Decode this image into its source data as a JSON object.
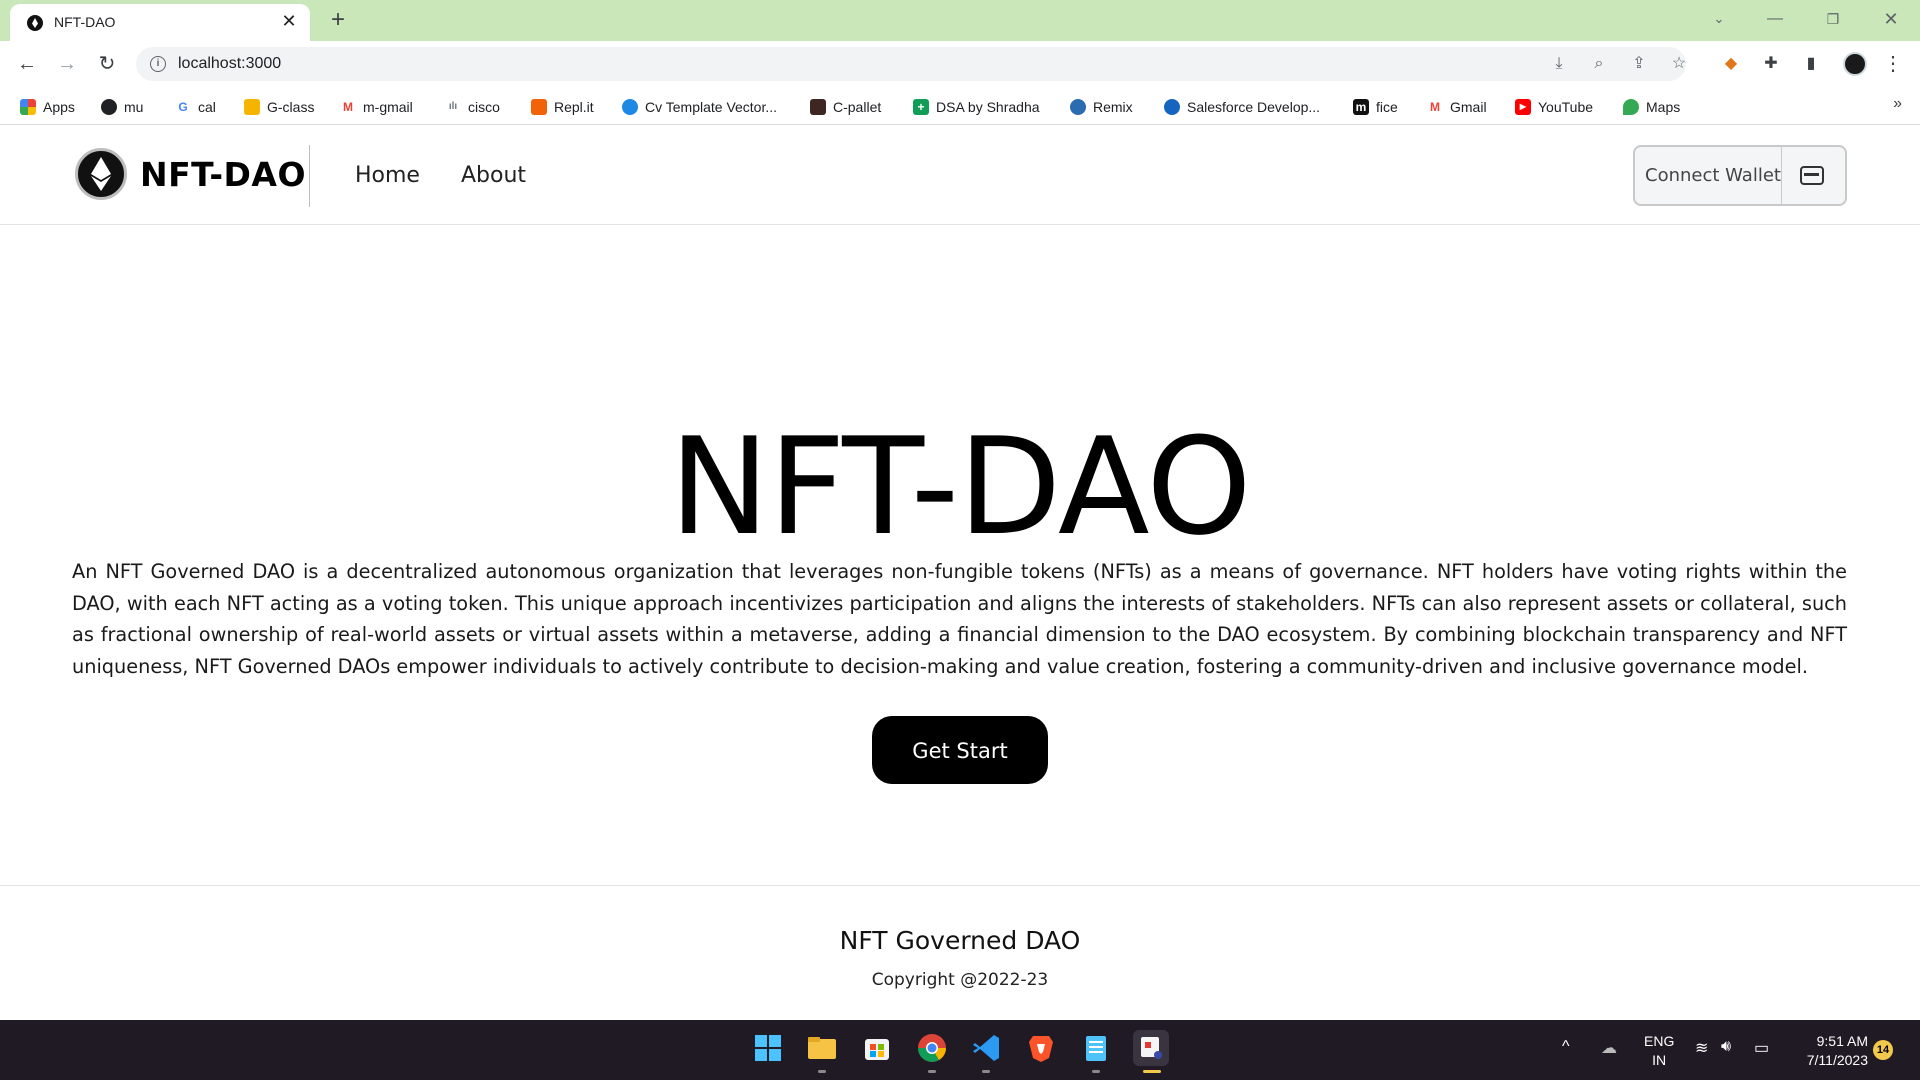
{
  "browser": {
    "tab_title": "NFT-DAO",
    "tab_close": "✕",
    "new_tab": "+",
    "url": "localhost:3000",
    "bookmarks": [
      {
        "label": "Apps",
        "icon": "apps-grid-icon",
        "color": "#ea4335"
      },
      {
        "label": "mu",
        "icon": "globe-icon",
        "color": "#202124"
      },
      {
        "label": "cal",
        "icon": "google-g-icon",
        "color": "#4285f4"
      },
      {
        "label": "G-class",
        "icon": "classroom-icon",
        "color": "#f4b400"
      },
      {
        "label": "m-gmail",
        "icon": "gmail-icon",
        "color": "#ea4335"
      },
      {
        "label": "cisco",
        "icon": "cisco-icon",
        "color": "#6c757d"
      },
      {
        "label": "Repl.it",
        "icon": "replit-icon",
        "color": "#f26207"
      },
      {
        "label": "Cv Template Vector...",
        "icon": "cv-icon",
        "color": "#1e88e5"
      },
      {
        "label": "C-pallet",
        "icon": "cup-icon",
        "color": "#3e2723"
      },
      {
        "label": "DSA by Shradha",
        "icon": "sheets-icon",
        "color": "#0f9d58"
      },
      {
        "label": "Remix",
        "icon": "remix-icon",
        "color": "#2b6cb0"
      },
      {
        "label": "Salesforce Develop...",
        "icon": "salesforce-icon",
        "color": "#1565c0"
      },
      {
        "label": "fice",
        "icon": "fice-icon",
        "color": "#111111"
      },
      {
        "label": "Gmail",
        "icon": "gmail-icon",
        "color": "#ea4335"
      },
      {
        "label": "YouTube",
        "icon": "youtube-icon",
        "color": "#ff0000"
      },
      {
        "label": "Maps",
        "icon": "maps-pin-icon",
        "color": "#34a853"
      }
    ],
    "bookmarks_more": "»"
  },
  "site": {
    "brand": "NFT-DAO",
    "nav": [
      "Home",
      "About"
    ],
    "connect_wallet": "Connect Wallet"
  },
  "hero": {
    "title": "NFT-DAO",
    "description": "An NFT Governed DAO is a decentralized autonomous organization that leverages non-fungible tokens (NFTs) as a means of governance. NFT holders have voting rights within the DAO, with each NFT acting as a voting token. This unique approach incentivizes participation and aligns the interests of stakeholders. NFTs can also represent assets or collateral, such as fractional ownership of real-world assets or virtual assets within a metaverse, adding a financial dimension to the DAO ecosystem. By combining blockchain transparency and NFT uniqueness, NFT Governed DAOs empower individuals to actively contribute to decision-making and value creation, fostering a community-driven and inclusive governance model.",
    "cta": "Get Start"
  },
  "footer": {
    "title": "NFT Governed DAO",
    "copyright": "Copyright @2022-23"
  },
  "taskbar": {
    "lang_top": "ENG",
    "lang_bottom": "IN",
    "time": "9:51 AM",
    "date": "7/11/2023",
    "notifications": "14"
  }
}
